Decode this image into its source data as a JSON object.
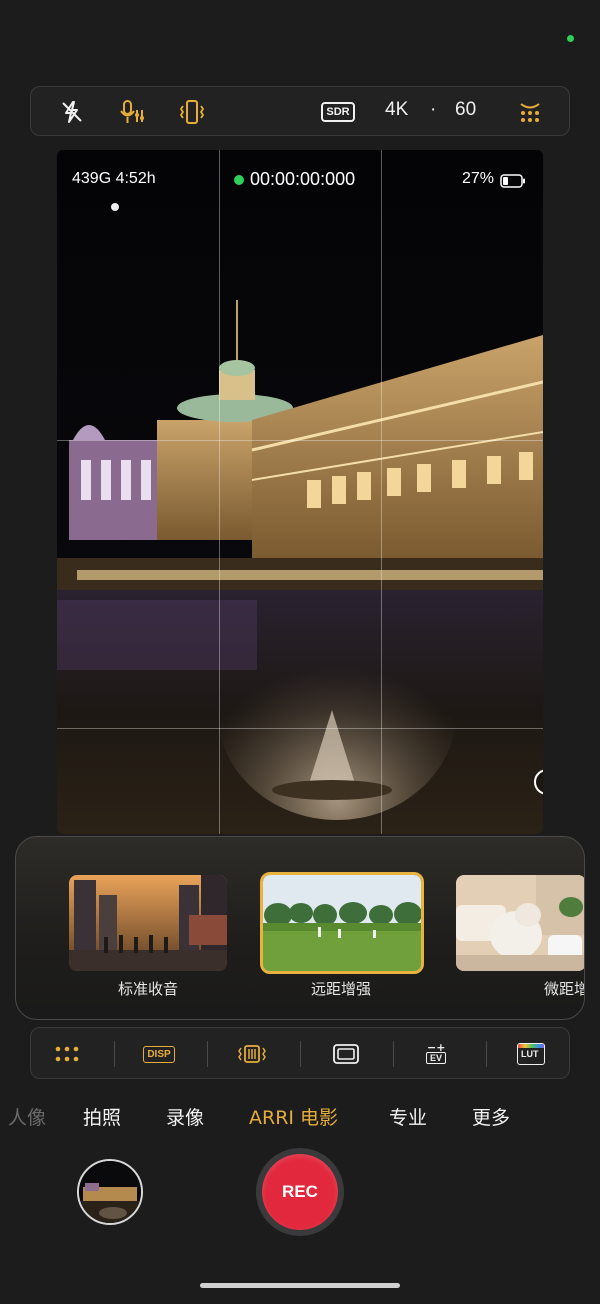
{
  "top_toolbar": {
    "icons": [
      "flash-off-icon",
      "microphone-settings-icon",
      "vibration-icon"
    ],
    "dynamic_range": "SDR",
    "resolution": "4K",
    "separator": "·",
    "fps": "60",
    "menu_icon": "more-grid-icon"
  },
  "viewfinder": {
    "storage": "439G 4:52h",
    "timecode": "00:00:00:000",
    "battery": "27%",
    "info_icon": "i"
  },
  "audio_modes": [
    {
      "label": "标准收音",
      "selected": false
    },
    {
      "label": "远距增强",
      "selected": true
    },
    {
      "label": "微距增强",
      "selected": false
    }
  ],
  "bottom_toolbar": {
    "icons": [
      "grid-dots-icon",
      "disp-icon",
      "stabilization-icon",
      "frame-icon",
      "ev-icon",
      "lut-icon"
    ],
    "disp_label": "DISP",
    "ev_label": "EV",
    "lut_label": "LUT"
  },
  "tabs": [
    {
      "label": "人像",
      "state": "faded"
    },
    {
      "label": "拍照",
      "state": "normal"
    },
    {
      "label": "录像",
      "state": "normal"
    },
    {
      "label": "ARRI 电影",
      "state": "active"
    },
    {
      "label": "专业",
      "state": "normal"
    },
    {
      "label": "更多",
      "state": "normal"
    }
  ],
  "controls": {
    "record_label": "REC"
  },
  "colors": {
    "accent": "#e7ad3a",
    "record": "#e2283d",
    "recording_dot": "#2fd05a"
  }
}
